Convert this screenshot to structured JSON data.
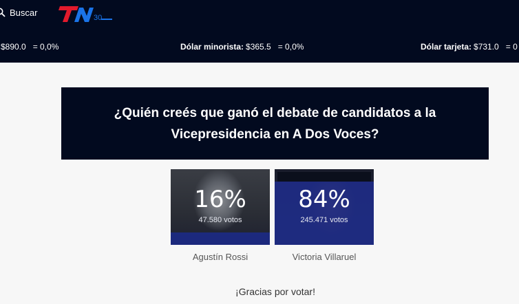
{
  "header": {
    "search_label": "Buscar",
    "logo_text": "TN",
    "logo_anniversary": "30",
    "brand_color": "#e21a2c",
    "accent_color": "#1a73e8"
  },
  "ticker": [
    {
      "label": "",
      "price": "$890.0",
      "variation": "= 0,0%"
    },
    {
      "label": "Dólar minorista:",
      "price": "$365.5",
      "variation": "= 0,0%"
    },
    {
      "label": "Dólar tarjeta:",
      "price": "$731.0",
      "variation": "= 0"
    }
  ],
  "poll": {
    "question": "¿Quién creés que ganó el debate de candidatos a la Vicepresidencia en A Dos Voces?",
    "options": [
      {
        "name": "Agustín Rossi",
        "percent_label": "16%",
        "percent": 16,
        "votes": "47.580 votos"
      },
      {
        "name": "Victoria Villaruel",
        "percent_label": "84%",
        "percent": 84,
        "votes": "245.471 votos"
      }
    ],
    "thanks": "¡Gracias por votar!"
  }
}
